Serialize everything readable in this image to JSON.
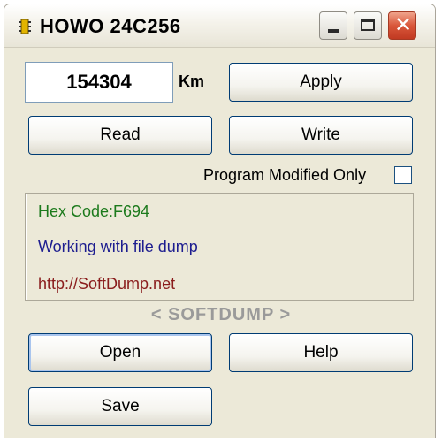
{
  "window": {
    "title": "HOWO 24C256",
    "icon": "chip-icon",
    "controls": {
      "minimize": "minimize-icon",
      "maximize": "maximize-icon",
      "close": "close-icon",
      "close_glyph": "✕"
    }
  },
  "mileage": {
    "value": "154304",
    "unit": "Km"
  },
  "buttons": {
    "apply": "Apply",
    "read": "Read",
    "write": "Write",
    "open": "Open",
    "help": "Help",
    "save": "Save"
  },
  "options": {
    "program_modified_only": {
      "label": "Program Modified Only",
      "checked": false
    }
  },
  "info": {
    "hex_code": "Hex Code:F694",
    "status": "Working with file dump",
    "url": "http://SoftDump.net"
  },
  "brand": "< SOFTDUMP >",
  "colors": {
    "window_bg": "#ece9d8",
    "hex_text": "#1c7a1c",
    "status_text": "#1d1d8f",
    "url_text": "#8a1c1c",
    "brand_text": "#9a9a9a",
    "close_button": "#d9563a"
  }
}
